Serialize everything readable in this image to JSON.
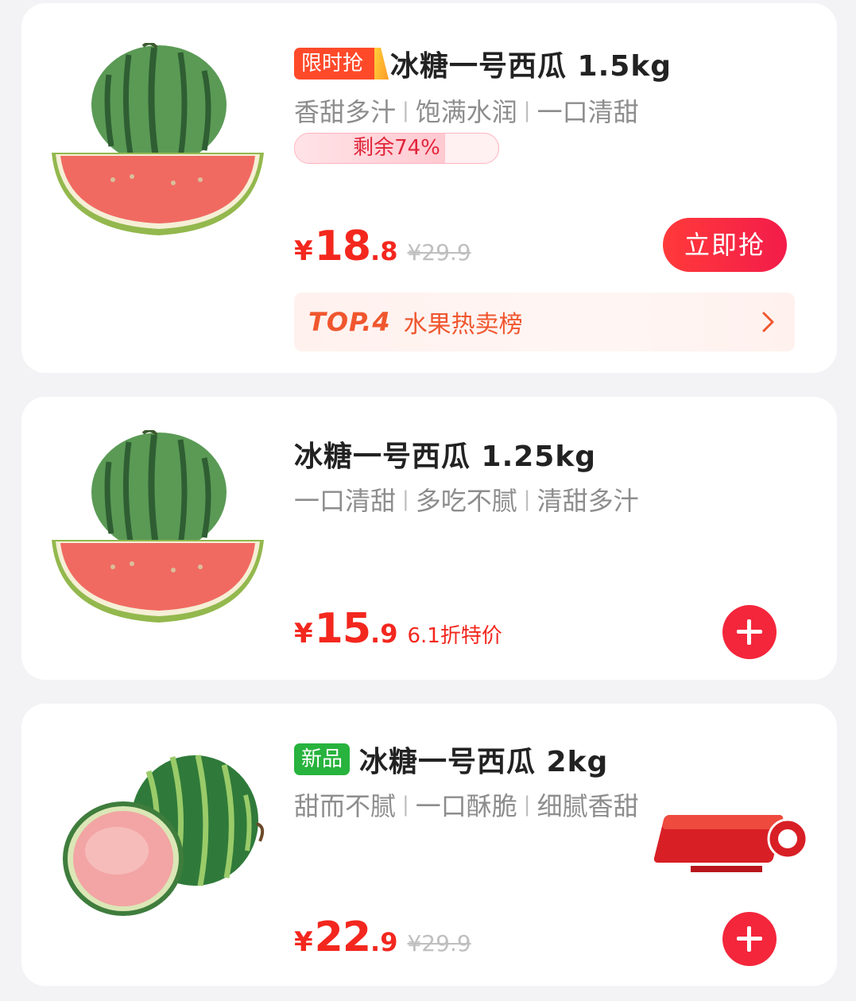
{
  "products": [
    {
      "tag": "限时抢",
      "title": "冰糖一号西瓜 1.5kg",
      "features": [
        "香甜多汁",
        "饱满水润",
        "一口清甜"
      ],
      "stock_label": "剩余74%",
      "stock_fraction": 0.74,
      "price_symbol": "¥",
      "price_int": "18",
      "price_dec": ".8",
      "original_price": "¥29.9",
      "buy_button": "立即抢",
      "rank": {
        "top": "TOP.4",
        "label": "水果热卖榜"
      }
    },
    {
      "title": "冰糖一号西瓜 1.25kg",
      "features": [
        "一口清甜",
        "多吃不腻",
        "清甜多汁"
      ],
      "price_symbol": "¥",
      "price_int": "15",
      "price_dec": ".9",
      "discount_label": "6.1折特价"
    },
    {
      "tag": "新品",
      "title": "冰糖一号西瓜 2kg",
      "features": [
        "甜而不腻",
        "一口酥脆",
        "细腻香甜"
      ],
      "price_symbol": "¥",
      "price_int": "22",
      "price_dec": ".9",
      "original_price": "¥29.9"
    }
  ],
  "colors": {
    "price": "#f3271e",
    "flash_tag": "#ff4a2a",
    "new_tag": "#27b33d",
    "button": "#f4263b"
  },
  "icons": [
    "watermelon-image",
    "chevron-right-icon",
    "plus-icon",
    "news-watermark-logo"
  ]
}
